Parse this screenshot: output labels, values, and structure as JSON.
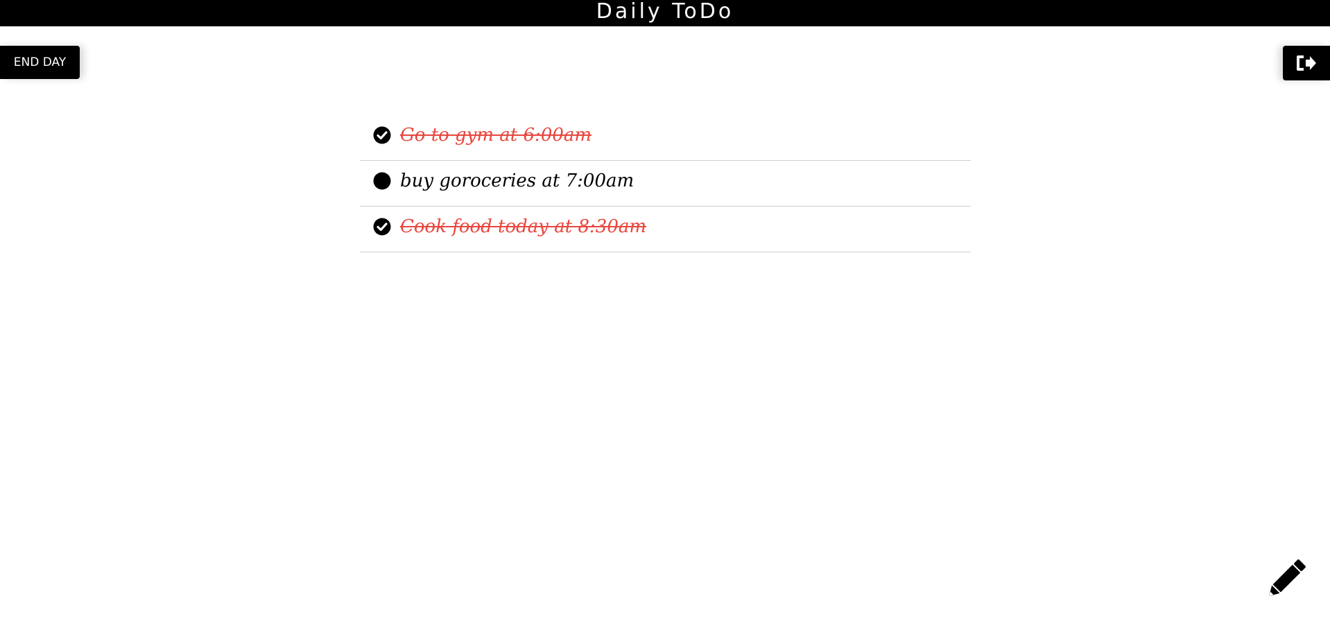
{
  "header": {
    "title": "Daily ToDo"
  },
  "toolbar": {
    "end_day_label": "END DAY",
    "logout_icon": "sign-out-icon",
    "edit_icon": "pencil-icon"
  },
  "todos": [
    {
      "text": "Go to gym at 6:00am",
      "done": true
    },
    {
      "text": "buy goroceries at 7:00am",
      "done": false
    },
    {
      "text": "Cook food today at 8:30am",
      "done": true
    }
  ],
  "colors": {
    "header_bg": "#000000",
    "done_text": "#e8473f",
    "pending_text": "#000000",
    "divider": "#cfcfcf"
  }
}
